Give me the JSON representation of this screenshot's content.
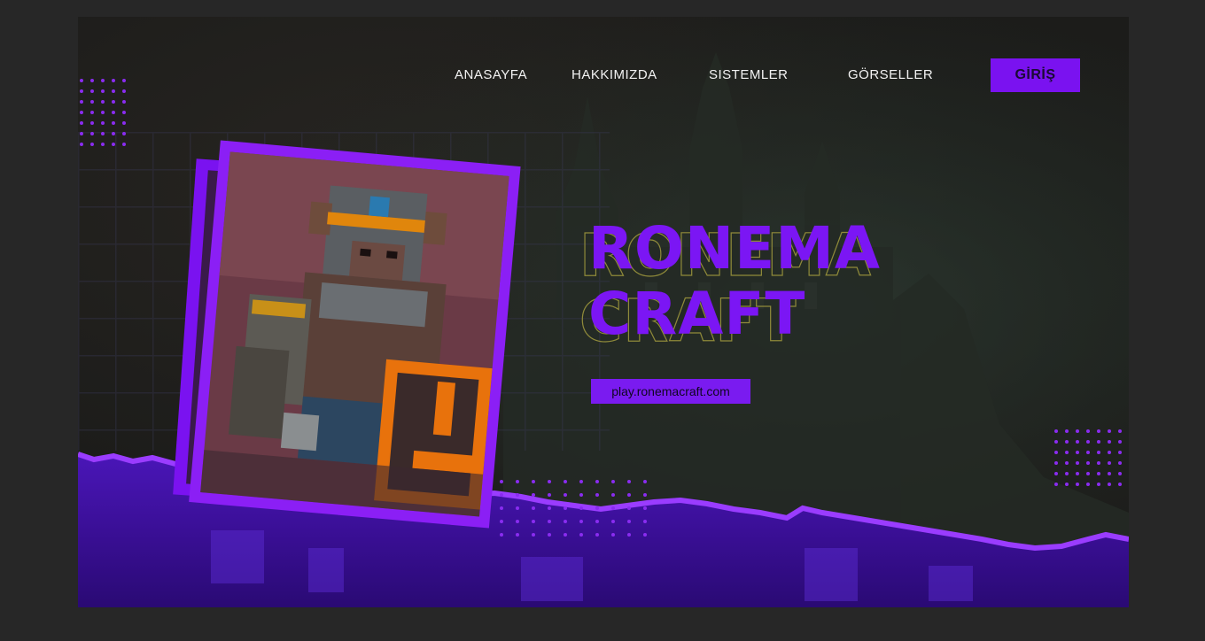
{
  "nav": {
    "links": [
      "ANASAYFA",
      "HAKKIMIZDA",
      "SISTEMLER",
      "GÖRSELLER"
    ],
    "login_label": "GİRİŞ"
  },
  "hero": {
    "title_line1": "RONEMA",
    "title_line2": "CRAFT",
    "server_ip": "play.ronemacraft.com"
  },
  "colors": {
    "accent": "#7a12f0",
    "background": "#1c1c1a",
    "page": "#272727"
  },
  "icons": [
    "dot-pattern",
    "minecraft-knight-illustration"
  ]
}
